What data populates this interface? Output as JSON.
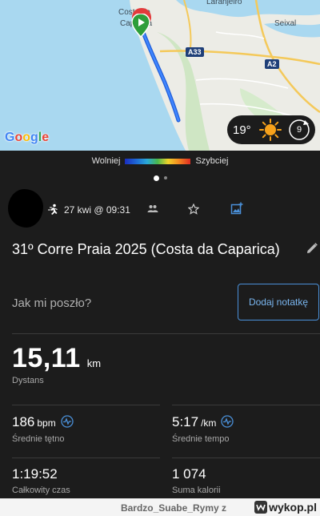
{
  "map": {
    "labels": [
      "Costa da",
      "Caparica",
      "Laranjeiro",
      "Seixal"
    ],
    "roads": [
      "A33",
      "A2"
    ],
    "attribution": "Google"
  },
  "weather": {
    "temperature": "19°",
    "wind": "9",
    "icon": "sun-icon"
  },
  "pace_legend": {
    "slower": "Wolniej",
    "faster": "Szybciej"
  },
  "carousel": {
    "pages": 2,
    "active": 0
  },
  "activity": {
    "datetime": "27 kwi @ 09:31",
    "title": "31º Corre Praia 2025 (Costa da Caparica)",
    "feedback_prompt": "Jak mi poszło?",
    "add_note_label": "Dodaj notatkę"
  },
  "stats": {
    "distance": {
      "value": "15,11",
      "unit": "km",
      "label": "Dystans"
    },
    "avg_hr": {
      "value": "186",
      "unit": "bpm",
      "label": "Średnie tętno"
    },
    "avg_pace": {
      "value": "5:17",
      "unit": "/km",
      "label": "Średnie tempo"
    },
    "total_time": {
      "value": "1:19:52",
      "label": "Całkowity czas"
    },
    "calories": {
      "value": "1 074",
      "label": "Suma kalorii"
    }
  },
  "footer": {
    "username": "Bardzo_Suabe_Rymy z",
    "site": "wykop.pl"
  }
}
